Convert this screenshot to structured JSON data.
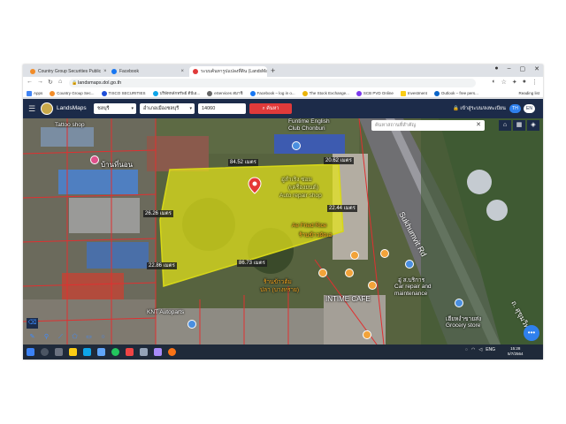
{
  "browser": {
    "tabs": [
      {
        "label": "Country Group Securities Public",
        "active": false
      },
      {
        "label": "Facebook",
        "active": false
      },
      {
        "label": "ระบบค้นหารูปแปลงที่ดิน (LandsMaps",
        "active": true
      }
    ],
    "new_tab": "+",
    "url": "landsmaps.dol.go.th",
    "bookmarks": [
      "Apps",
      "Country Group Sec...",
      "TISCO SECURITIES",
      "บริษัทหลักทรัพย์ ดีบีเอ...",
      "eServices สมาชิ",
      "Facebook – log in o...",
      "The Stock Exchange...",
      "SCB PVD Online",
      "Investment",
      "Outlook – free pers..."
    ],
    "reading_list": "Reading list"
  },
  "app": {
    "brand": "LandsMaps",
    "province": "ชลบุรี",
    "district": "อำเภอเมืองชลบุรี",
    "postcode": "14060",
    "search_label": "ค้นหา",
    "login_link": "เข้าสู่ระบบ/ลงทะเบียน",
    "lang_th": "TH",
    "lang_en": "EN",
    "map_search_placeholder": "ค้นหาสถานที่สำคัญ"
  },
  "map": {
    "places": {
      "english_club": "Funtime English",
      "english_club_2": "Club Chonburi",
      "tattoo": "Tattoo shop",
      "house": "บ้านที่นอน",
      "auto_repair_th": "อู่สำเริง ซ่อม",
      "auto_repair_th2": "(เครื่องยนต์)",
      "auto_repair": "Auto repair shop",
      "fried_rice": "Ae Fried Rice",
      "fried_rice_th": "ร้านข้าวผัดเอ",
      "rice_shop": "ร้านข้าวต้ม",
      "rice_shop_2": "ปลา (บางทราย)",
      "knt": "KNT Autoparts",
      "cafe": "INTIME CAFE",
      "car_repair_th": "อู่ ส.บริการ",
      "car_repair": "Car repair and",
      "car_repair_2": "maintenance",
      "grocery_th": "เฮียหงำขายส่ง",
      "grocery": "Grocery store",
      "road": "Sukhumvit Rd",
      "road_th": "ถ. สุขุมวิท"
    },
    "measurements": {
      "top": "84.52 เมตร",
      "top_right": "20.62 เมตร",
      "left_upper": "26.26 เมตร",
      "right": "22.44 เมตร",
      "left_lower": "22.86 เมตร",
      "bottom": "86.73 เมตร"
    }
  },
  "taskbar": {
    "lang": "ENG",
    "time": "15:28",
    "date": "5/7/2564"
  },
  "colors": {
    "header": "#1c2b49",
    "search_button": "#e03a3a",
    "parcel_fill": "#e5e51a",
    "parcel_outline": "#e03030"
  }
}
